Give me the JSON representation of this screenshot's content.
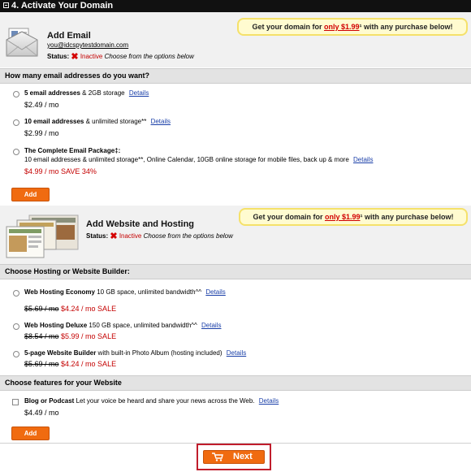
{
  "header": {
    "title": "4. Activate Your Domain"
  },
  "promo": {
    "prefix": "Get your domain for ",
    "price": "only $1.99",
    "suffix": "¹ with any purchase below!"
  },
  "email": {
    "title": "Add Email",
    "address": "you@idcspytestdomain.com",
    "status_label": "Status:",
    "status_value": "Inactive",
    "status_hint": "Choose from the options below",
    "question": "How many email addresses do you want?",
    "options": [
      {
        "name": "5 email addresses",
        "desc": " & 2GB storage",
        "details": "Details",
        "price": "$2.49 / mo"
      },
      {
        "name": "10 email addresses",
        "desc": " & unlimited storage**",
        "details": "Details",
        "price": "$2.99 / mo"
      },
      {
        "name": "The Complete Email Package‡:",
        "desc": "10 email addresses & unlimited storage**, Online Calendar, 10GB online storage for mobile files, back up & more",
        "details": "Details",
        "price": "$4.99 / mo SAVE 34%"
      }
    ],
    "add_label": "Add"
  },
  "hosting": {
    "title": "Add Website and Hosting",
    "status_label": "Status:",
    "status_value": "Inactive",
    "status_hint": "Choose from the options below",
    "question": "Choose Hosting or Website Builder:",
    "options": [
      {
        "name": "Web Hosting Economy",
        "desc": " 10 GB space, unlimited bandwidth^^",
        "details": "Details",
        "old_price": "$5.69 / mo",
        "new_price": " $4.24 / mo SALE"
      },
      {
        "name": "Web Hosting Deluxe",
        "desc": " 150 GB space, unlimited bandwidth^^",
        "details": "Details",
        "old_price": "$8.54 / mo",
        "new_price": " $5.99 / mo SALE"
      },
      {
        "name": "5-page Website Builder",
        "desc": " with built-in Photo Album (hosting included)",
        "details": "Details",
        "old_price": "$5.69 / mo",
        "new_price": " $4.24 / mo SALE"
      }
    ],
    "features_question": "Choose features for your Website",
    "feature": {
      "name": "Blog or Podcast",
      "desc": " Let your voice be heard and share your news across the Web.",
      "details": "Details",
      "price": "$4.49 / mo"
    },
    "add_label": "Add"
  },
  "footer": {
    "next_label": "Next"
  },
  "colors": {
    "accent": "#f06b10",
    "status_red": "#c40000",
    "title_bar": "#111111",
    "promo_bg": "#fffbd0"
  }
}
